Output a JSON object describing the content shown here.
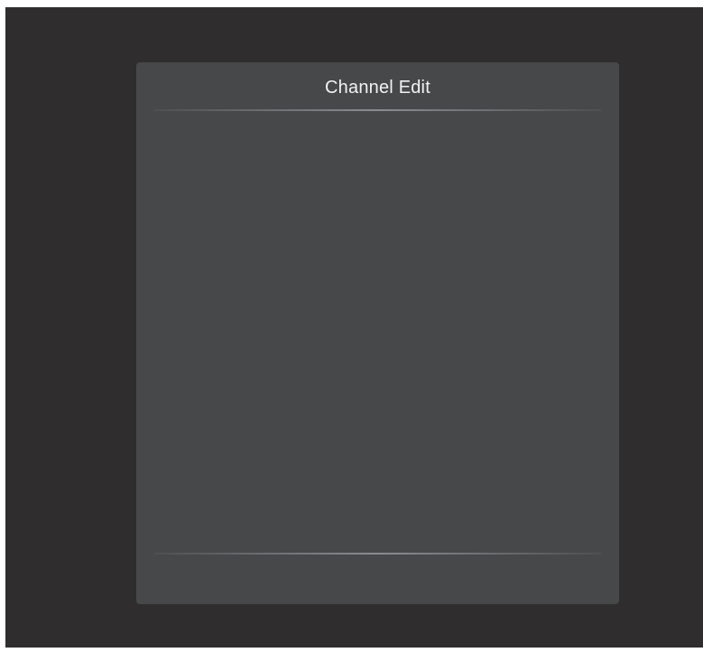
{
  "dialog": {
    "title": "Channel Edit"
  },
  "colors": {
    "screen_background": "#2f2d2e",
    "dialog_background": "#47484a",
    "title_text": "#f2f2f2",
    "divider": "#96989b"
  }
}
